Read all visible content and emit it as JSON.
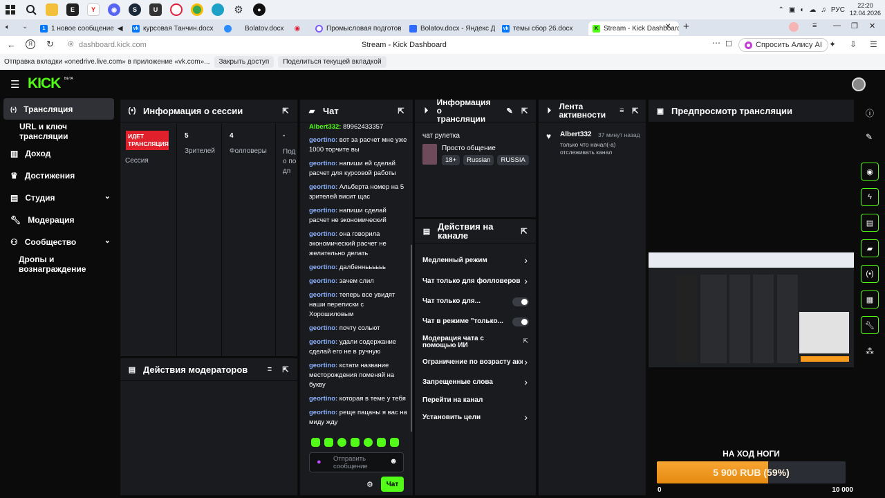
{
  "taskbar": {
    "apps": [
      "windows-logo",
      "search",
      "file-explorer",
      "epic-games",
      "yandex",
      "discord",
      "steam",
      "unity",
      "opera",
      "chrome",
      "edge",
      "settings",
      "app"
    ],
    "lang": "РУС",
    "time": "22:20",
    "date": "12.04.2026"
  },
  "tabs": [
    {
      "label": "1 новое сообщение",
      "fav": "vk",
      "color": "#0077ff"
    },
    {
      "label": "курсовая Танчин.docx",
      "fav": "vk",
      "color": "#0077ff"
    },
    {
      "label": "Bolatov.docx",
      "fav": "cloud",
      "color": "#2b8cff"
    },
    {
      "label": "Промысловая подготовк",
      "fav": "o",
      "color": "#7b5cff"
    },
    {
      "label": "Bolatov.docx - Яндекс Док",
      "fav": "doc",
      "color": "#2f6bff"
    },
    {
      "label": "темы сбор 26.docx",
      "fav": "vk",
      "color": "#0077ff"
    },
    {
      "label": "Stream - Kick Dashboard",
      "fav": "K",
      "color": "#53fc18"
    }
  ],
  "address": {
    "url": "dashboard.kick.com",
    "page_title": "Stream - Kick Dashboard",
    "alice": "Спросить Алису AI"
  },
  "infobar": {
    "text": "Отправка вкладки «onedrive.live.com» в приложение «vk.com»...",
    "close_access": "Закрыть доступ",
    "share_tab": "Поделиться текущей вкладкой"
  },
  "kick": {
    "logo": "KICK",
    "beta": "BETA",
    "nav": [
      {
        "label": "Трансляция",
        "icon": "broadcast"
      },
      {
        "label": "URL и ключ трансляции",
        "icon": ""
      },
      {
        "label": "Доход",
        "icon": "chart"
      },
      {
        "label": "Достижения",
        "icon": "trophy"
      },
      {
        "label": "Студия",
        "icon": "studio"
      },
      {
        "label": "Модерация",
        "icon": "wrench"
      },
      {
        "label": "Сообщество",
        "icon": "people"
      },
      {
        "label": "Дропы и вознаграждение",
        "icon": ""
      }
    ],
    "session": {
      "title": "Информация о сессии",
      "live_badge": "ИДЕТ ТРАНСЛЯЦИЯ",
      "session_label": "Сессия",
      "viewers_value": "5",
      "viewers_label": "Зрителей",
      "followers_value": "4",
      "followers_label": "Фолловеры",
      "extra_value": "-",
      "extra_label": "Подо подп"
    },
    "mod_actions": {
      "title": "Действия модераторов"
    },
    "chat": {
      "title": "Чат",
      "top_line": {
        "user": "Albert332:",
        "text": " 89962433357"
      },
      "messages": [
        {
          "user": "geortino:",
          "text": " вот за расчет мне уже 1000 торчите вы"
        },
        {
          "user": "geortino:",
          "text": " напиши ей сделай расчет для курсовой работы"
        },
        {
          "user": "geortino:",
          "text": " Альберта номер на 5 зрителей висит щас"
        },
        {
          "user": "geortino:",
          "text": " напиши сделай расчет не экономический"
        },
        {
          "user": "geortino:",
          "text": " она говорила экономический расчет не желательно делать"
        },
        {
          "user": "geortino:",
          "text": " далбенньььььь"
        },
        {
          "user": "geortino:",
          "text": " зачем слил"
        },
        {
          "user": "geortino:",
          "text": " теперь все увидят наши переписки с Хорошиловым"
        },
        {
          "user": "geortino:",
          "text": " почту сольют"
        },
        {
          "user": "geortino:",
          "text": " удали содержание сделай его не в ручную"
        },
        {
          "user": "geortino:",
          "text": " кстати название месторождения поменяй на букву"
        },
        {
          "user": "geortino:",
          "text": " которая в теме у тебя"
        },
        {
          "user": "geortino:",
          "text": " реще пацаны я вас на миду жду"
        }
      ],
      "input_placeholder": "Отправить сообщение",
      "send_label": "Чат"
    },
    "stream_info": {
      "title": "Информация о трансляции",
      "stream_title": "чат рулетка",
      "category": "Просто общение",
      "tags": [
        "18+",
        "Russian",
        "RUSSIA"
      ]
    },
    "channel_actions": {
      "title": "Действия на канале",
      "items": [
        {
          "label": "Медленный режим",
          "control": "chevron"
        },
        {
          "label": "Чат только для фолловеров",
          "control": "chevron"
        },
        {
          "label": "Чат только для...",
          "control": "toggle"
        },
        {
          "label": "Чат в режиме \"только...",
          "control": "toggle"
        },
        {
          "label": "Модерация чата с помощью ИИ",
          "control": "external"
        },
        {
          "label": "Ограничение по возрасту акк",
          "control": "chevron"
        },
        {
          "label": "Запрещенные слова",
          "control": "chevron"
        },
        {
          "label": "Перейти на канал",
          "control": "none"
        },
        {
          "label": "Установить цели",
          "control": "chevron"
        }
      ]
    },
    "activity": {
      "title": "Лента активности",
      "item": {
        "user": "Albert332",
        "time": "37 минут назад",
        "text": "только что начал(-а) отслеживать канал"
      }
    },
    "preview": {
      "title": "Предпросмотр трансляции",
      "goal_title": "НА ХОД НОГИ",
      "goal_text": "5 900 RUB (59%)",
      "goal_progress": 0.59,
      "goal_min": "0",
      "goal_max": "10 000"
    },
    "colors": {
      "accent": "#53fc18",
      "panel": "#191b1f",
      "live": "#e0202a",
      "goal": "#f59a1c"
    }
  }
}
